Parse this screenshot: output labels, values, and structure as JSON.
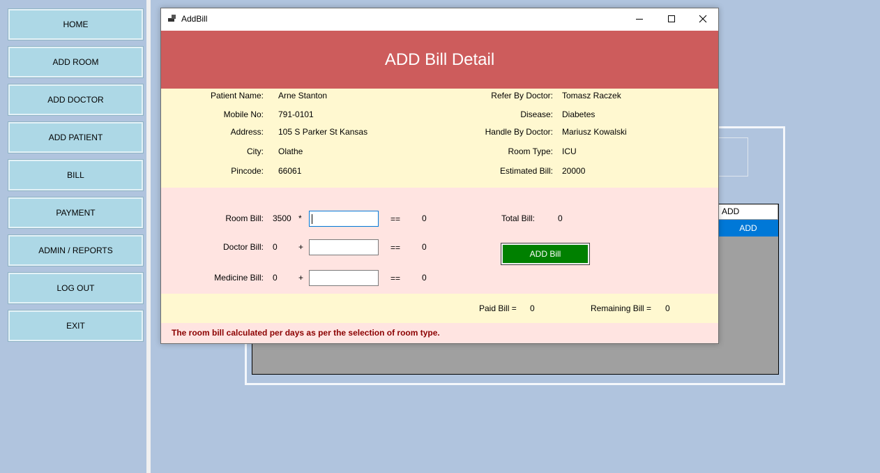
{
  "nav": {
    "items": [
      {
        "label": "HOME"
      },
      {
        "label": "ADD ROOM"
      },
      {
        "label": "ADD DOCTOR"
      },
      {
        "label": "ADD PATIENT"
      },
      {
        "label": "BILL"
      },
      {
        "label": "PAYMENT"
      },
      {
        "label": "ADMIN / REPORTS"
      },
      {
        "label": "LOG OUT"
      },
      {
        "label": "EXIT"
      }
    ]
  },
  "background_grid": {
    "column_header": "ADD",
    "selected_cell": "ADD"
  },
  "dialog": {
    "window_title": "AddBill",
    "header_title": "ADD Bill Detail",
    "patient": {
      "name_label": "Patient Name:",
      "name": "Arne Stanton",
      "mobile_label": "Mobile No:",
      "mobile": "791-0101",
      "address_label": "Address:",
      "address": "105 S Parker St Kansas",
      "city_label": "City:",
      "city": "Olathe",
      "pincode_label": "Pincode:",
      "pincode": "66061"
    },
    "case": {
      "refer_label": "Refer By Doctor:",
      "refer": "Tomasz Raczek",
      "disease_label": "Disease:",
      "disease": "Diabetes",
      "handle_label": "Handle By Doctor:",
      "handle": "Mariusz Kowalski",
      "room_type_label": "Room Type:",
      "room_type": "ICU",
      "estimated_label": "Estimated Bill:",
      "estimated": "20000"
    },
    "calc": {
      "room": {
        "label": "Room Bill:",
        "base": "3500",
        "op": "*",
        "input": "",
        "eq": "==",
        "result": "0"
      },
      "doctor": {
        "label": "Doctor Bill:",
        "base": "0",
        "op": "+",
        "input": "",
        "eq": "==",
        "result": "0"
      },
      "medicine": {
        "label": "Medicine Bill:",
        "base": "0",
        "op": "+",
        "input": "",
        "eq": "==",
        "result": "0"
      },
      "total_label": "Total Bill:",
      "total": "0",
      "add_button": "ADD Bill"
    },
    "totals": {
      "paid_label": "Paid Bill =",
      "paid": "0",
      "remaining_label": "Remaining Bill =",
      "remaining": "0"
    },
    "note": "The room bill calculated per days as per the selection of room type."
  },
  "colors": {
    "desktop": "#b0c4de",
    "nav_button": "#add8e6",
    "header": "#cd5c5c",
    "info_panel": "#fff8d0",
    "calc_panel": "#ffe4e1",
    "add_button": "#008000",
    "note_text": "#8b0000",
    "selection": "#0078d7"
  }
}
